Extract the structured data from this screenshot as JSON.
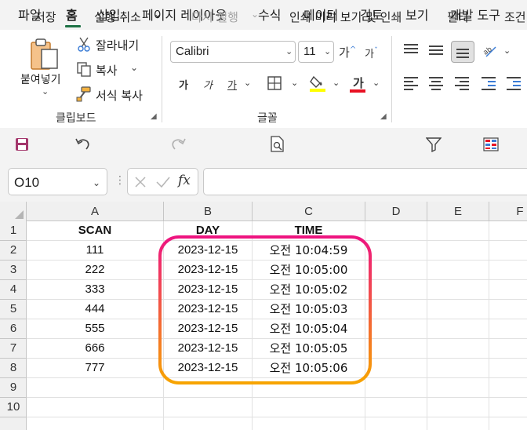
{
  "menu": {
    "items": [
      {
        "label": "파일",
        "active": false
      },
      {
        "label": "홈",
        "active": true
      },
      {
        "label": "삽입",
        "active": false
      },
      {
        "label": "페이지 레이아웃",
        "active": false
      },
      {
        "label": "수식",
        "active": false
      },
      {
        "label": "데이터",
        "active": false
      },
      {
        "label": "검토",
        "active": false
      },
      {
        "label": "보기",
        "active": false
      },
      {
        "label": "개발 도구",
        "active": false
      }
    ]
  },
  "ribbon": {
    "clipboard": {
      "paste_label": "붙여넣기",
      "cut_label": "잘라내기",
      "copy_label": "복사",
      "format_painter_label": "서식 복사",
      "group_label": "클립보드"
    },
    "font": {
      "font_name": "Calibri",
      "font_size": "11",
      "grow_label": "가",
      "shrink_label": "가",
      "bold_label": "가",
      "italic_label": "가",
      "underline_label": "가",
      "font_color_label": "가",
      "group_label": "글꼴",
      "highlight_color": "#ffff00",
      "font_color": "#e81123"
    }
  },
  "qat": {
    "save_label": "저장",
    "undo_label": "실행 취소",
    "redo_label": "다시 실행",
    "print_preview_label": "인쇄 미리 보기 및 인쇄",
    "filter_label": "필터",
    "conditional_label": "조건"
  },
  "formula_bar": {
    "name_box": "O10",
    "fx_label": "fx",
    "formula": ""
  },
  "grid": {
    "columns": [
      "A",
      "B",
      "C",
      "D",
      "E",
      "F"
    ],
    "rows": [
      "1",
      "2",
      "3",
      "4",
      "5",
      "6",
      "7",
      "8",
      "9",
      "10"
    ],
    "header": {
      "a": "SCAN",
      "b": "DAY",
      "c": "TIME"
    },
    "data": [
      {
        "scan": "111",
        "day": "2023-12-15",
        "time": "오전 10:04:59"
      },
      {
        "scan": "222",
        "day": "2023-12-15",
        "time": "오전 10:05:00"
      },
      {
        "scan": "333",
        "day": "2023-12-15",
        "time": "오전 10:05:02"
      },
      {
        "scan": "444",
        "day": "2023-12-15",
        "time": "오전 10:05:03"
      },
      {
        "scan": "555",
        "day": "2023-12-15",
        "time": "오전 10:05:04"
      },
      {
        "scan": "666",
        "day": "2023-12-15",
        "time": "오전 10:05:05"
      },
      {
        "scan": "777",
        "day": "2023-12-15",
        "time": "오전 10:05:06"
      }
    ]
  },
  "annotation": {
    "gradient_top": "#ee1480",
    "gradient_bottom": "#f7a400"
  },
  "colors": {
    "accent": "#1e7145",
    "chrome": "#f3f3f3",
    "header_bg": "#f0f0f0"
  }
}
